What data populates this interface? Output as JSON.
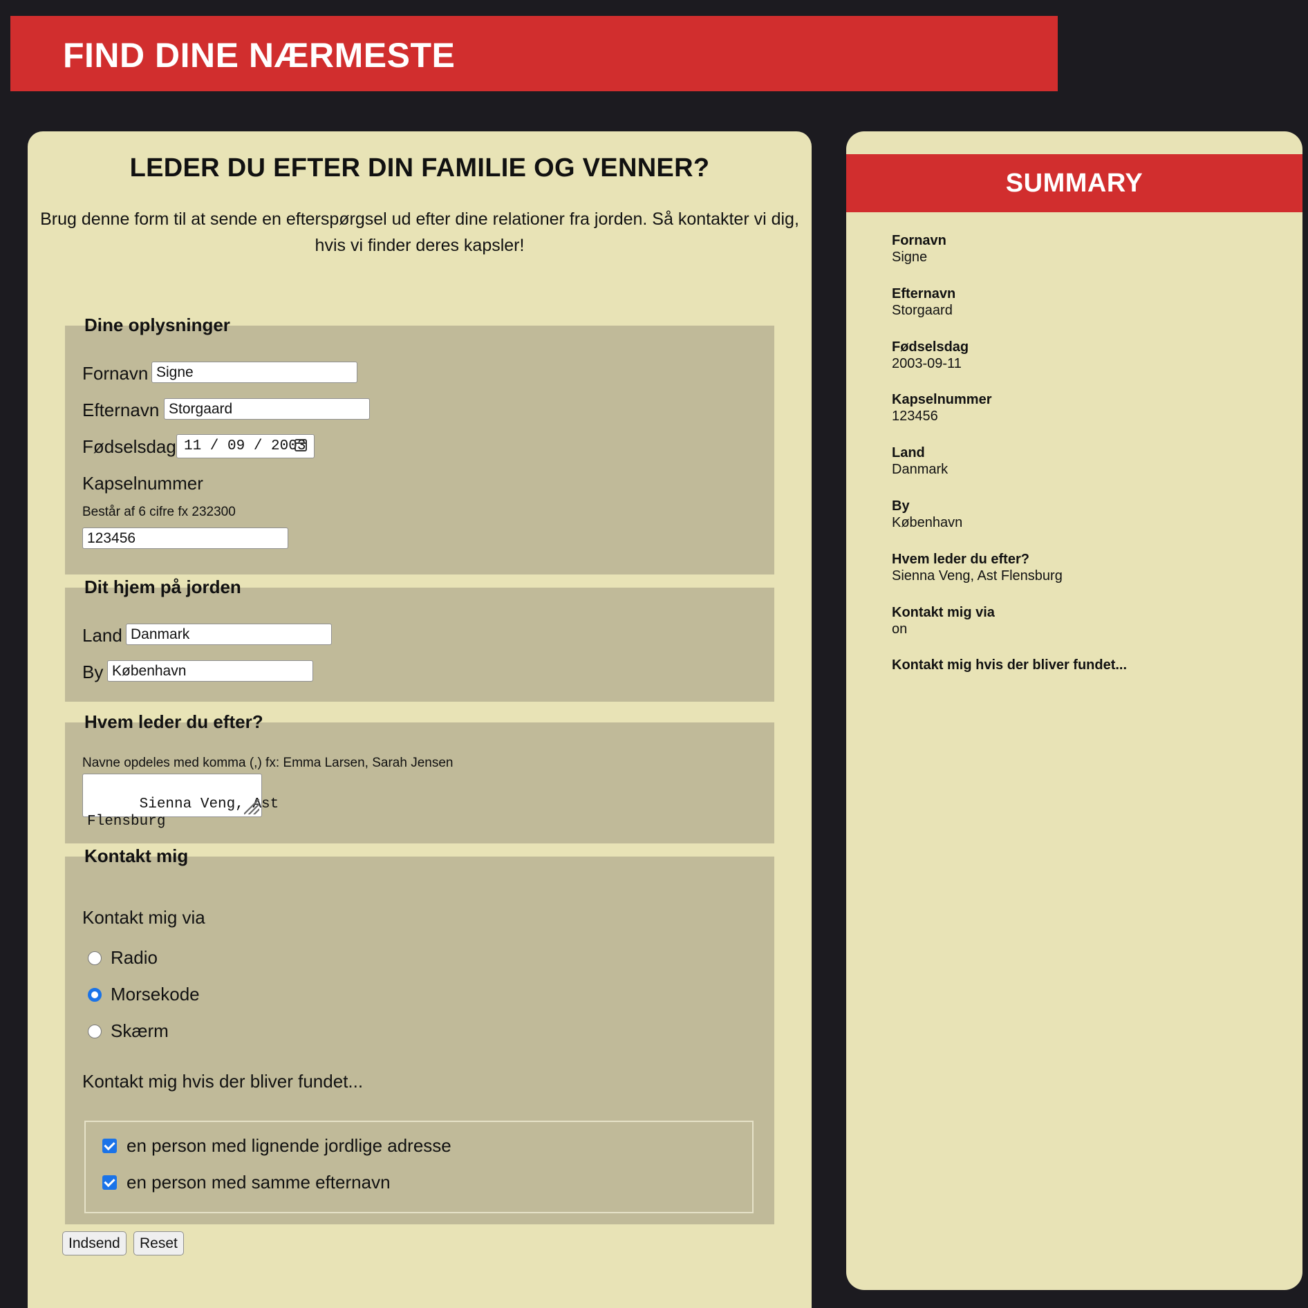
{
  "header": {
    "title": "FIND DINE NÆRMESTE"
  },
  "main": {
    "title": "LEDER DU EFTER DIN FAMILIE OG VENNER?",
    "intro_line1": "Brug denne form til at sende en efterspørgsel ud efter dine relationer fra jorden. Så kontakter vi dig,",
    "intro_line2": "hvis vi finder deres kapsler!"
  },
  "form": {
    "personal": {
      "legend": "Dine oplysninger",
      "fornavn_label": "Fornavn",
      "fornavn_value": "Signe",
      "efternavn_label": "Efternavn",
      "efternavn_value": "Storgaard",
      "birthday_label": "Fødselsdag",
      "birthday_value": "11 / 09 / 2003",
      "capsule_label": "Kapselnummer",
      "capsule_hint": "Består af 6 cifre fx 232300",
      "capsule_value": "123456"
    },
    "home": {
      "legend": "Dit hjem på jorden",
      "country_label": "Land",
      "country_value": "Danmark",
      "city_label": "By",
      "city_value": "København"
    },
    "search": {
      "legend": "Hvem leder du efter?",
      "hint": "Navne opdeles med komma (,) fx: Emma Larsen, Sarah Jensen",
      "value": "Sienna Veng, Ast\nFlensburg"
    },
    "contact": {
      "legend": "Kontakt mig",
      "via_label": "Kontakt mig via",
      "options": [
        {
          "label": "Radio",
          "selected": false
        },
        {
          "label": "Morsekode",
          "selected": true
        },
        {
          "label": "Skærm",
          "selected": false
        }
      ],
      "found_label": "Kontakt mig hvis der bliver fundet...",
      "checkboxes": [
        {
          "label": "en person med lignende jordlige adresse",
          "checked": true
        },
        {
          "label": "en person med samme efternavn",
          "checked": true
        }
      ]
    },
    "buttons": {
      "submit": "Indsend",
      "reset": "Reset"
    }
  },
  "summary": {
    "title": "SUMMARY",
    "items": [
      {
        "key": "Fornavn",
        "value": "Signe"
      },
      {
        "key": "Efternavn",
        "value": "Storgaard"
      },
      {
        "key": "Fødselsdag",
        "value": "2003-09-11"
      },
      {
        "key": "Kapselnummer",
        "value": "123456"
      },
      {
        "key": "Land",
        "value": "Danmark"
      },
      {
        "key": "By",
        "value": "København"
      },
      {
        "key": "Hvem leder du efter?",
        "value": "Sienna Veng, Ast Flensburg"
      },
      {
        "key": "Kontakt mig via",
        "value": "on"
      },
      {
        "key": "Kontakt mig hvis der bliver fundet...",
        "value": ""
      }
    ]
  },
  "colors": {
    "accent": "#d12e2e",
    "page_bg": "#1c1b20",
    "card_bg": "#e8e3b6",
    "fieldset_bg": "#c0ba99",
    "control_blue": "#1a73e8"
  }
}
